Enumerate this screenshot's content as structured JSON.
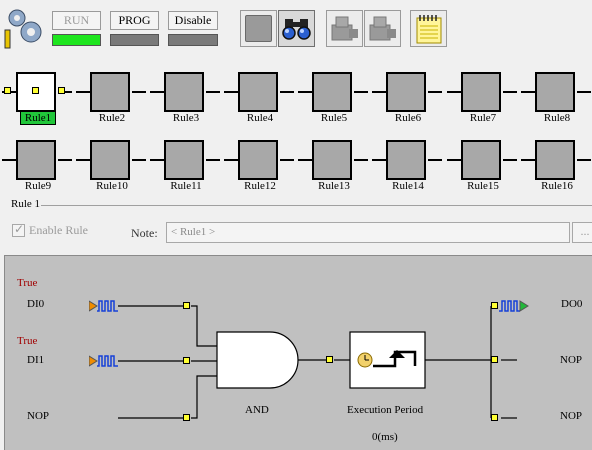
{
  "toolbar": {
    "run_label": "RUN",
    "prog_label": "PROG",
    "disable_label": "Disable",
    "colors": {
      "run_bar": "#1ee51e",
      "inactive_bar": "#7a7a7a"
    }
  },
  "rules": [
    {
      "label": "Rule1",
      "selected": true
    },
    {
      "label": "Rule2"
    },
    {
      "label": "Rule3"
    },
    {
      "label": "Rule4"
    },
    {
      "label": "Rule5"
    },
    {
      "label": "Rule6"
    },
    {
      "label": "Rule7"
    },
    {
      "label": "Rule8"
    },
    {
      "label": "Rule9"
    },
    {
      "label": "Rule10"
    },
    {
      "label": "Rule11"
    },
    {
      "label": "Rule12"
    },
    {
      "label": "Rule13"
    },
    {
      "label": "Rule14"
    },
    {
      "label": "Rule15"
    },
    {
      "label": "Rule16"
    }
  ],
  "rule_group": {
    "title": "Rule 1",
    "enable_rule_label": "Enable Rule",
    "enable_rule_checked": true,
    "note_label": "Note:",
    "note_value": "< Rule1 >",
    "browse_label": "..."
  },
  "diagram": {
    "inputs": [
      {
        "state": "True",
        "name": "DI0"
      },
      {
        "state": "True",
        "name": "DI1"
      },
      {
        "state": "",
        "name": "NOP"
      }
    ],
    "gate_label": "AND",
    "period_label": "Execution Period",
    "period_value": "0(ms)",
    "outputs": [
      {
        "name": "DO0"
      },
      {
        "name": "NOP"
      },
      {
        "name": "NOP"
      }
    ]
  }
}
